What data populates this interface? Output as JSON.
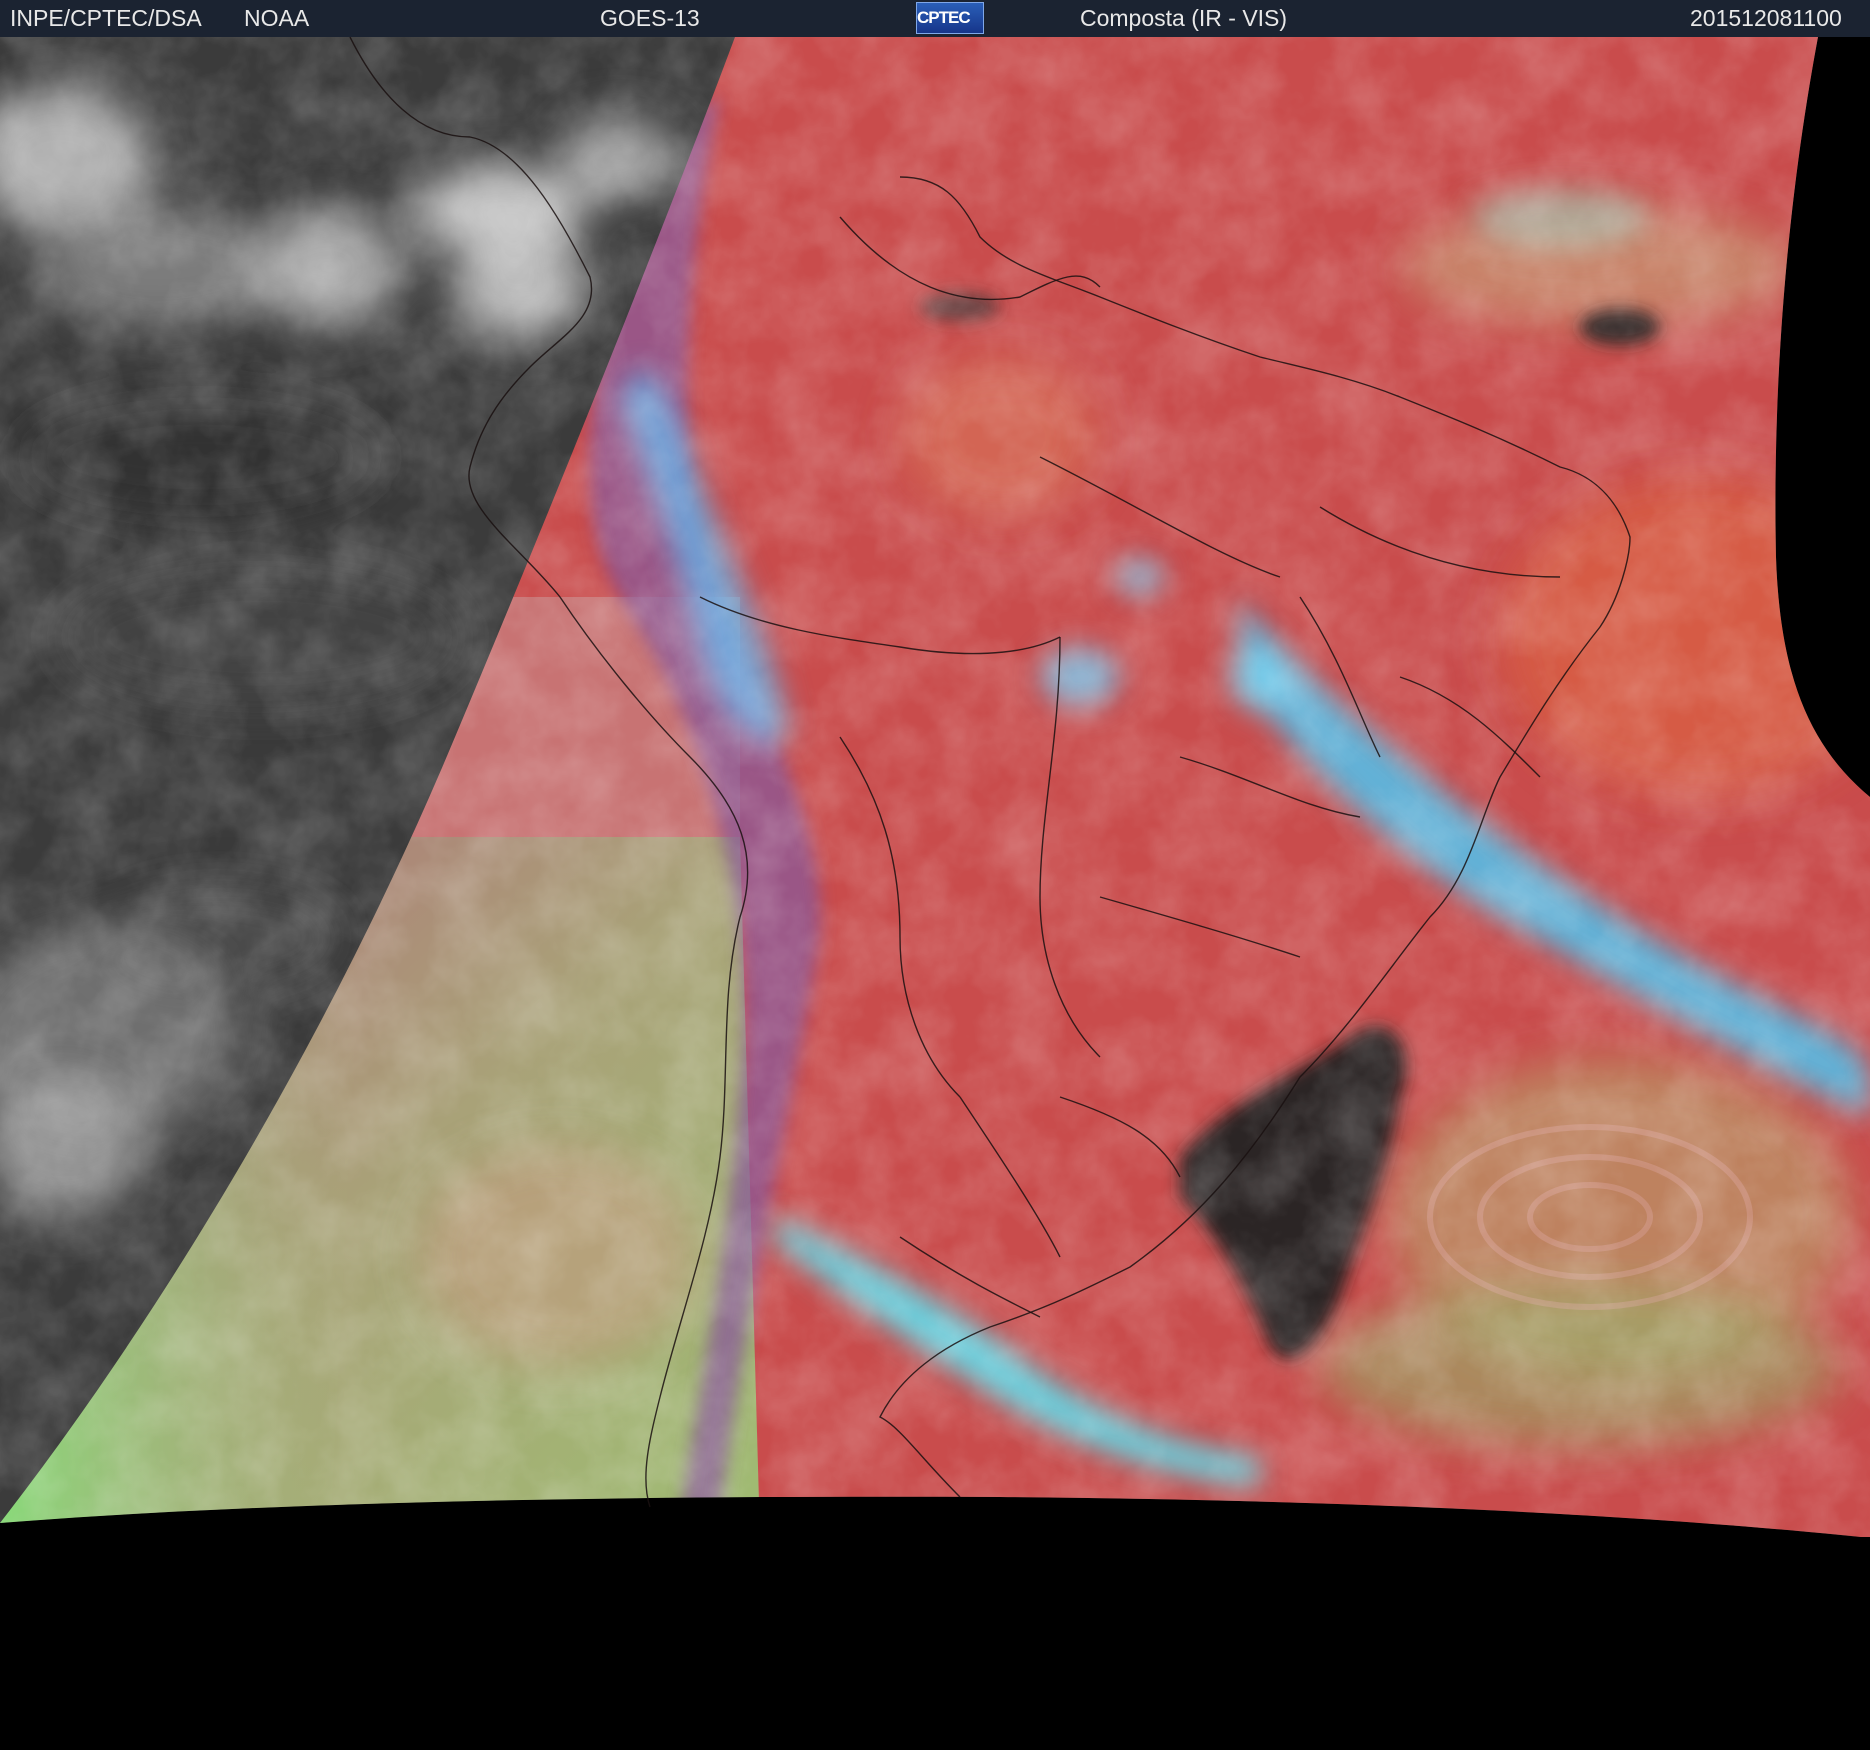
{
  "header": {
    "institution": "INPE/CPTEC/DSA",
    "agency": "NOAA",
    "satellite": "GOES-13",
    "logo_text": "CPTEC",
    "product": "Composta (IR - VIS)",
    "timestamp": "201512081100"
  },
  "colors": {
    "header_bg": "#1b2331",
    "ocean_red": "#c44a4a",
    "night_gray": "#3a3a3a",
    "cloud_cyan": "#5fd8f0",
    "sea_green": "#8fb070",
    "no_data": "#000000"
  }
}
